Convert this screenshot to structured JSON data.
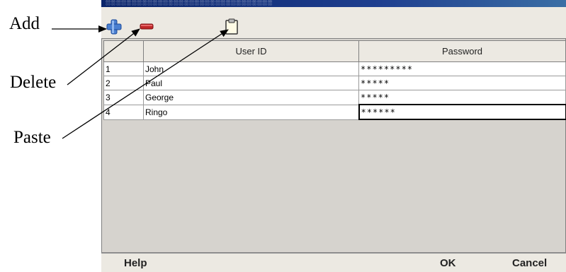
{
  "annotations": {
    "add": "Add",
    "delete": "Delete",
    "paste": "Paste"
  },
  "toolbar": {
    "add_icon": "plus-icon",
    "delete_icon": "minus-icon",
    "paste_icon": "clipboard-icon"
  },
  "table": {
    "headers": [
      "",
      "User ID",
      "Password"
    ],
    "rows": [
      {
        "index": "1",
        "user_id": "John",
        "password": "*********"
      },
      {
        "index": "2",
        "user_id": "Paul",
        "password": "*****"
      },
      {
        "index": "3",
        "user_id": "George",
        "password": "*****"
      },
      {
        "index": "4",
        "user_id": "Ringo",
        "password": "******"
      }
    ]
  },
  "buttons": {
    "help": "Help",
    "ok": "OK",
    "cancel": "Cancel"
  },
  "colors": {
    "titlebar": "#0a246a",
    "add_icon": "#4a7fd0",
    "delete_icon": "#c0282a"
  }
}
